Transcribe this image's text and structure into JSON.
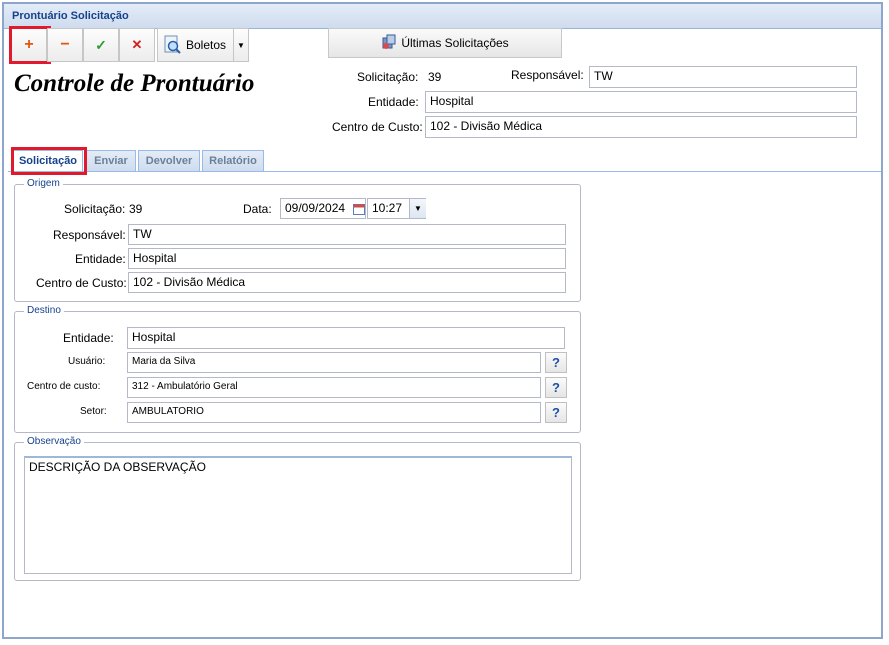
{
  "window": {
    "title": "Prontuário Solicitação"
  },
  "toolbar": {
    "add_glyph": "+",
    "remove_glyph": "−",
    "confirm_glyph": "✓",
    "cancel_glyph": "✕",
    "boletos_label": "Boletos",
    "ultimas_label": "Últimas Solicitações"
  },
  "header": {
    "title": "Controle de Prontuário",
    "solicitacao_label": "Solicitação:",
    "solicitacao_value": "39",
    "responsavel_label": "Responsável:",
    "responsavel_value": "TW",
    "entidade_label": "Entidade:",
    "entidade_value": "Hospital",
    "centro_label": "Centro de Custo:",
    "centro_value": "102 - Divisão Médica"
  },
  "tabs": [
    {
      "label": "Solicitação",
      "active": true
    },
    {
      "label": "Enviar",
      "active": false
    },
    {
      "label": "Devolver",
      "active": false
    },
    {
      "label": "Relatório",
      "active": false
    }
  ],
  "origem": {
    "legend": "Origem",
    "solicitacao_label": "Solicitação:",
    "solicitacao_value": "39",
    "data_label": "Data:",
    "date_value": "09/09/2024",
    "time_value": "10:27",
    "responsavel_label": "Responsável:",
    "responsavel_value": "TW",
    "entidade_label": "Entidade:",
    "entidade_value": "Hospital",
    "centro_label": "Centro de Custo:",
    "centro_value": "102 - Divisão Médica"
  },
  "destino": {
    "legend": "Destino",
    "entidade_label": "Entidade:",
    "entidade_value": "Hospital",
    "usuario_label": "Usuário:",
    "usuario_value": "Maria da Silva",
    "centro_label": "Centro de custo:",
    "centro_value": "312 - Ambulatório Geral",
    "setor_label": "Setor:",
    "setor_value": "AMBULATORIO",
    "lookup_glyph": "?"
  },
  "observacao": {
    "legend": "Observação",
    "text": "DESCRIÇÃO DA OBSERVAÇÃO"
  },
  "colors": {
    "accent": "#15428b",
    "highlight": "#e0192d",
    "border": "#99bbe8"
  }
}
